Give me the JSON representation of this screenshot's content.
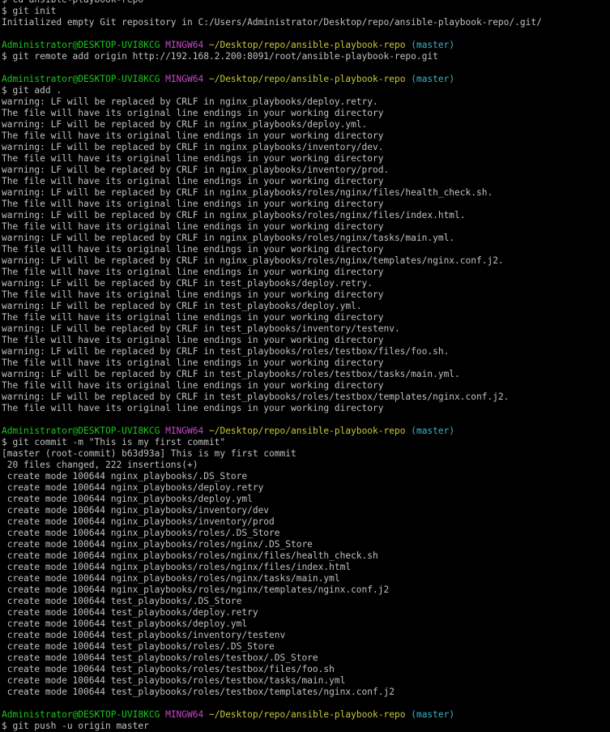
{
  "terminal": {
    "colors": {
      "background": "#000000",
      "text": "#c0c0c0",
      "user": "#1cc81c",
      "system": "#c847c8",
      "path": "#c8c83a",
      "branch": "#3ab4c8"
    },
    "lines": [
      {
        "type": "text",
        "text": "$ cd ansible-playbook-repo"
      },
      {
        "type": "text",
        "text": "$ git init"
      },
      {
        "type": "text",
        "text": "Initialized empty Git repository in C:/Users/Administrator/Desktop/repo/ansible-playbook-repo/.git/"
      },
      {
        "type": "blank"
      },
      {
        "type": "prompt",
        "user": "Administrator@DESKTOP-UVI8KCG",
        "system": "MINGW64",
        "path": "~/Desktop/repo/ansible-playbook-repo",
        "branch": "(master)"
      },
      {
        "type": "text",
        "text": "$ git remote add origin http://192.168.2.200:8091/root/ansible-playbook-repo.git"
      },
      {
        "type": "blank"
      },
      {
        "type": "prompt",
        "user": "Administrator@DESKTOP-UVI8KCG",
        "system": "MINGW64",
        "path": "~/Desktop/repo/ansible-playbook-repo",
        "branch": "(master)"
      },
      {
        "type": "text",
        "text": "$ git add ."
      },
      {
        "type": "text",
        "text": "warning: LF will be replaced by CRLF in nginx_playbooks/deploy.retry."
      },
      {
        "type": "text",
        "text": "The file will have its original line endings in your working directory"
      },
      {
        "type": "text",
        "text": "warning: LF will be replaced by CRLF in nginx_playbooks/deploy.yml."
      },
      {
        "type": "text",
        "text": "The file will have its original line endings in your working directory"
      },
      {
        "type": "text",
        "text": "warning: LF will be replaced by CRLF in nginx_playbooks/inventory/dev."
      },
      {
        "type": "text",
        "text": "The file will have its original line endings in your working directory"
      },
      {
        "type": "text",
        "text": "warning: LF will be replaced by CRLF in nginx_playbooks/inventory/prod."
      },
      {
        "type": "text",
        "text": "The file will have its original line endings in your working directory"
      },
      {
        "type": "text",
        "text": "warning: LF will be replaced by CRLF in nginx_playbooks/roles/nginx/files/health_check.sh."
      },
      {
        "type": "text",
        "text": "The file will have its original line endings in your working directory"
      },
      {
        "type": "text",
        "text": "warning: LF will be replaced by CRLF in nginx_playbooks/roles/nginx/files/index.html."
      },
      {
        "type": "text",
        "text": "The file will have its original line endings in your working directory"
      },
      {
        "type": "text",
        "text": "warning: LF will be replaced by CRLF in nginx_playbooks/roles/nginx/tasks/main.yml."
      },
      {
        "type": "text",
        "text": "The file will have its original line endings in your working directory"
      },
      {
        "type": "text",
        "text": "warning: LF will be replaced by CRLF in nginx_playbooks/roles/nginx/templates/nginx.conf.j2."
      },
      {
        "type": "text",
        "text": "The file will have its original line endings in your working directory"
      },
      {
        "type": "text",
        "text": "warning: LF will be replaced by CRLF in test_playbooks/deploy.retry."
      },
      {
        "type": "text",
        "text": "The file will have its original line endings in your working directory"
      },
      {
        "type": "text",
        "text": "warning: LF will be replaced by CRLF in test_playbooks/deploy.yml."
      },
      {
        "type": "text",
        "text": "The file will have its original line endings in your working directory"
      },
      {
        "type": "text",
        "text": "warning: LF will be replaced by CRLF in test_playbooks/inventory/testenv."
      },
      {
        "type": "text",
        "text": "The file will have its original line endings in your working directory"
      },
      {
        "type": "text",
        "text": "warning: LF will be replaced by CRLF in test_playbooks/roles/testbox/files/foo.sh."
      },
      {
        "type": "text",
        "text": "The file will have its original line endings in your working directory"
      },
      {
        "type": "text",
        "text": "warning: LF will be replaced by CRLF in test_playbooks/roles/testbox/tasks/main.yml."
      },
      {
        "type": "text",
        "text": "The file will have its original line endings in your working directory"
      },
      {
        "type": "text",
        "text": "warning: LF will be replaced by CRLF in test_playbooks/roles/testbox/templates/nginx.conf.j2."
      },
      {
        "type": "text",
        "text": "The file will have its original line endings in your working directory"
      },
      {
        "type": "blank"
      },
      {
        "type": "prompt",
        "user": "Administrator@DESKTOP-UVI8KCG",
        "system": "MINGW64",
        "path": "~/Desktop/repo/ansible-playbook-repo",
        "branch": "(master)"
      },
      {
        "type": "text",
        "text": "$ git commit -m \"This is my first commit\""
      },
      {
        "type": "text",
        "text": "[master (root-commit) b63d93a] This is my first commit"
      },
      {
        "type": "text",
        "text": " 20 files changed, 222 insertions(+)"
      },
      {
        "type": "text",
        "text": " create mode 100644 nginx_playbooks/.DS_Store"
      },
      {
        "type": "text",
        "text": " create mode 100644 nginx_playbooks/deploy.retry"
      },
      {
        "type": "text",
        "text": " create mode 100644 nginx_playbooks/deploy.yml"
      },
      {
        "type": "text",
        "text": " create mode 100644 nginx_playbooks/inventory/dev"
      },
      {
        "type": "text",
        "text": " create mode 100644 nginx_playbooks/inventory/prod"
      },
      {
        "type": "text",
        "text": " create mode 100644 nginx_playbooks/roles/.DS_Store"
      },
      {
        "type": "text",
        "text": " create mode 100644 nginx_playbooks/roles/nginx/.DS_Store"
      },
      {
        "type": "text",
        "text": " create mode 100644 nginx_playbooks/roles/nginx/files/health_check.sh"
      },
      {
        "type": "text",
        "text": " create mode 100644 nginx_playbooks/roles/nginx/files/index.html"
      },
      {
        "type": "text",
        "text": " create mode 100644 nginx_playbooks/roles/nginx/tasks/main.yml"
      },
      {
        "type": "text",
        "text": " create mode 100644 nginx_playbooks/roles/nginx/templates/nginx.conf.j2"
      },
      {
        "type": "text",
        "text": " create mode 100644 test_playbooks/.DS_Store"
      },
      {
        "type": "text",
        "text": " create mode 100644 test_playbooks/deploy.retry"
      },
      {
        "type": "text",
        "text": " create mode 100644 test_playbooks/deploy.yml"
      },
      {
        "type": "text",
        "text": " create mode 100644 test_playbooks/inventory/testenv"
      },
      {
        "type": "text",
        "text": " create mode 100644 test_playbooks/roles/.DS_Store"
      },
      {
        "type": "text",
        "text": " create mode 100644 test_playbooks/roles/testbox/.DS_Store"
      },
      {
        "type": "text",
        "text": " create mode 100644 test_playbooks/roles/testbox/files/foo.sh"
      },
      {
        "type": "text",
        "text": " create mode 100644 test_playbooks/roles/testbox/tasks/main.yml"
      },
      {
        "type": "text",
        "text": " create mode 100644 test_playbooks/roles/testbox/templates/nginx.conf.j2"
      },
      {
        "type": "blank"
      },
      {
        "type": "prompt",
        "user": "Administrator@DESKTOP-UVI8KCG",
        "system": "MINGW64",
        "path": "~/Desktop/repo/ansible-playbook-repo",
        "branch": "(master)"
      },
      {
        "type": "text",
        "text": "$ git push -u origin master"
      }
    ]
  }
}
